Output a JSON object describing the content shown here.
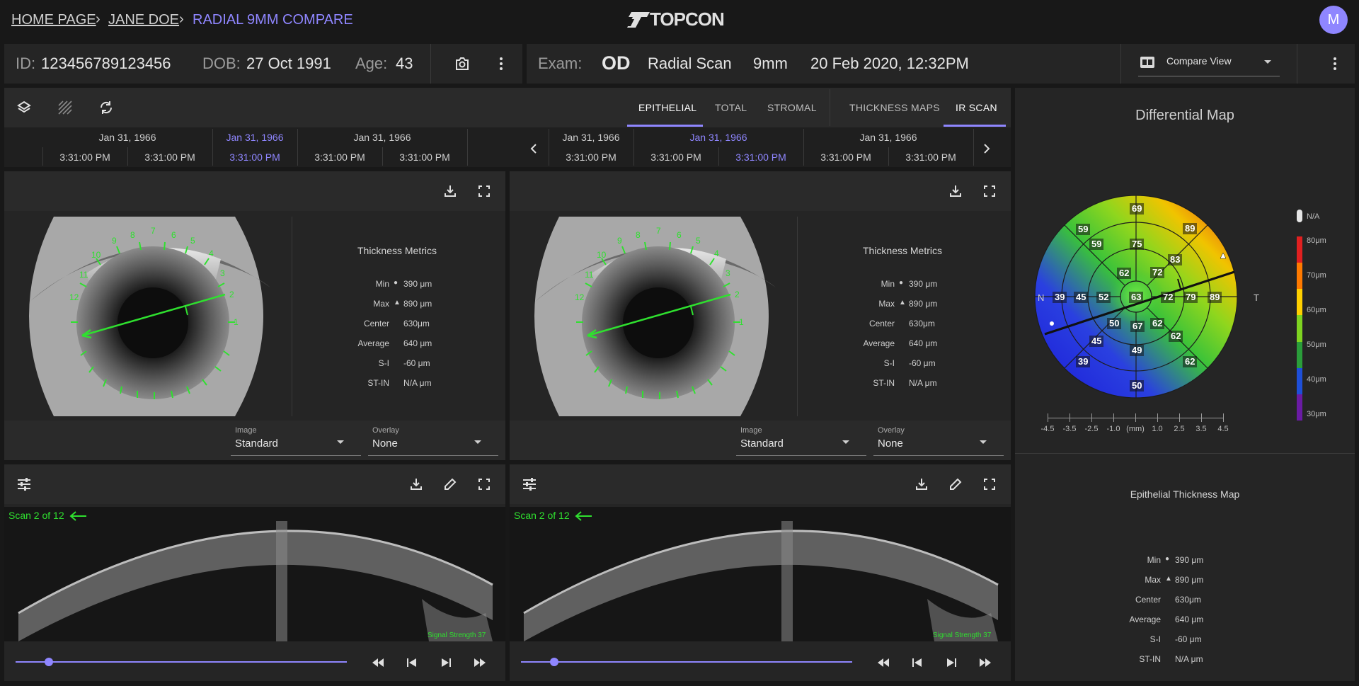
{
  "breadcrumb": {
    "home": "HOME PAGE",
    "patient": "JANE DOE",
    "current": "RADIAL 9MM COMPARE"
  },
  "brand": "TOPCON",
  "user": {
    "avatar_initial": "M"
  },
  "patient": {
    "id_label": "ID:",
    "id": "123456789123456",
    "dob_label": "DOB:",
    "dob": "27 Oct 1991",
    "age_label": "Age:",
    "age": "43"
  },
  "exam": {
    "label": "Exam:",
    "eye": "OD",
    "type": "Radial Scan",
    "size": "9mm",
    "datetime": "20 Feb 2020, 12:32PM",
    "view": "Compare View"
  },
  "tabs": [
    "EPITHELIAL",
    "TOTAL",
    "STROMAL",
    "THICKNESS MAPS",
    "IR SCAN"
  ],
  "timeline": {
    "left": [
      {
        "date": "Jan 31, 1966",
        "times": [
          "3:31:00 PM",
          "3:31:00 PM"
        ]
      },
      {
        "date": "Jan 31, 1966",
        "times": [
          "3:31:00 PM"
        ],
        "selected": true
      },
      {
        "date": "Jan 31, 1966",
        "times": [
          "3:31:00 PM",
          "3:31:00 PM"
        ]
      }
    ],
    "right": [
      {
        "date": "Jan 31, 1966",
        "times": [
          "3:31:00 PM"
        ]
      },
      {
        "date": "Jan 31, 1966",
        "times": [
          "3:31:00 PM",
          "3:31:00 PM"
        ],
        "selected": true
      },
      {
        "date": "Jan 31, 1966",
        "times": [
          "3:31:00 PM",
          "3:31:00 PM"
        ]
      }
    ],
    "left_flat": [
      "3:31:00 PM",
      "3:31:00 PM",
      "3:31:00 PM",
      "3:31:00 PM",
      "3:31:00 PM"
    ],
    "right_flat": [
      "3:31:00 PM",
      "3:31:00 PM",
      "3:31:00 PM",
      "3:31:00 PM",
      "3:31:00 PM"
    ]
  },
  "metrics": {
    "title": "Thickness Metrics",
    "rows": [
      {
        "label": "Min",
        "marker": "●",
        "value": "390 μm"
      },
      {
        "label": "Max",
        "marker": "▲",
        "value": "890 μm"
      },
      {
        "label": "Center",
        "marker": "",
        "value": "630μm"
      },
      {
        "label": "Average",
        "marker": "",
        "value": "640 μm"
      },
      {
        "label": "S-I",
        "marker": "",
        "value": "-60 μm"
      },
      {
        "label": "ST-IN",
        "marker": "",
        "value": "N/A μm"
      }
    ]
  },
  "selects": {
    "image_label": "Image",
    "image_value": "Standard",
    "overlay_label": "Overlay",
    "overlay_value": "None"
  },
  "scan": {
    "label": "Scan 2 of 12",
    "signal": "Signal Strength 37",
    "slider_fraction": 0.1
  },
  "clock_numbers": [
    "1",
    "2",
    "3",
    "4",
    "5",
    "6",
    "7",
    "8",
    "9",
    "10",
    "11",
    "12"
  ],
  "differential": {
    "title": "Differential Map",
    "nasal": "N",
    "temporal": "T",
    "values": {
      "center": "63",
      "ring1": [
        "72",
        "72",
        "67",
        "52"
      ],
      "ring2": [
        "75",
        "83",
        "79",
        "62",
        "49",
        "50",
        "45",
        "62"
      ],
      "ring3": [
        "69",
        "89",
        "89",
        "62",
        "50",
        "39",
        "39",
        "59"
      ],
      "extra": [
        "59",
        "45",
        "62"
      ]
    },
    "scale_ticks": [
      "-4.5",
      "-3.5",
      "-2.5",
      "-1.0",
      "(mm)",
      "1.0",
      "2.5",
      "3.5",
      "4.5"
    ],
    "legend": [
      "N/A",
      "80μm",
      "70μm",
      "60μm",
      "50μm",
      "40μm",
      "30μm"
    ],
    "legend_colors": [
      "#e02020",
      "#ff7a00",
      "#ffd000",
      "#7ed321",
      "#2a9d3a",
      "#1e4fd8",
      "#6a1ba3"
    ]
  },
  "epithelial_map": {
    "title": "Epithelial Thickness Map"
  },
  "colors": {
    "accent": "#8f86ff",
    "green": "#2fe02f",
    "panel": "#252525",
    "bg": "#181818"
  }
}
